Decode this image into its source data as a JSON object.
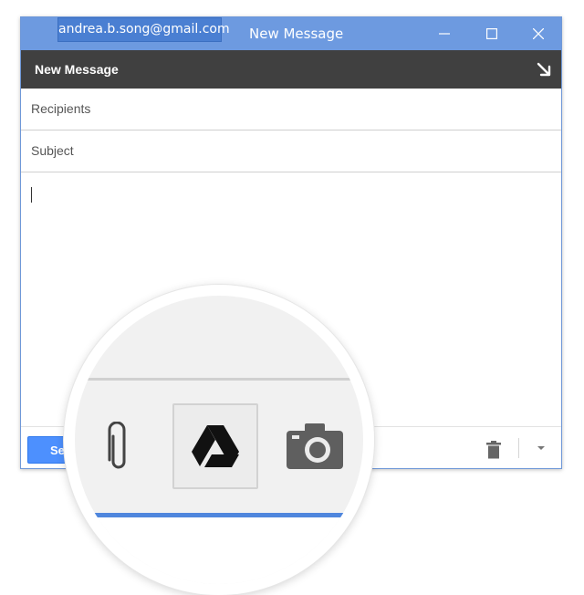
{
  "window": {
    "account": "andrea.b.song@gmail.com",
    "title": "New Message"
  },
  "compose": {
    "title": "New Message",
    "recipients_placeholder": "Recipients",
    "subject_placeholder": "Subject",
    "send_label": "Send"
  },
  "colors": {
    "titlebar": "#6d9ae0",
    "header": "#404040",
    "send": "#4d90fe"
  },
  "icons": {
    "attach": "paperclip-icon",
    "drive": "google-drive-icon",
    "photo": "camera-icon",
    "discard": "trash-icon",
    "more": "dropdown-arrow-icon"
  }
}
